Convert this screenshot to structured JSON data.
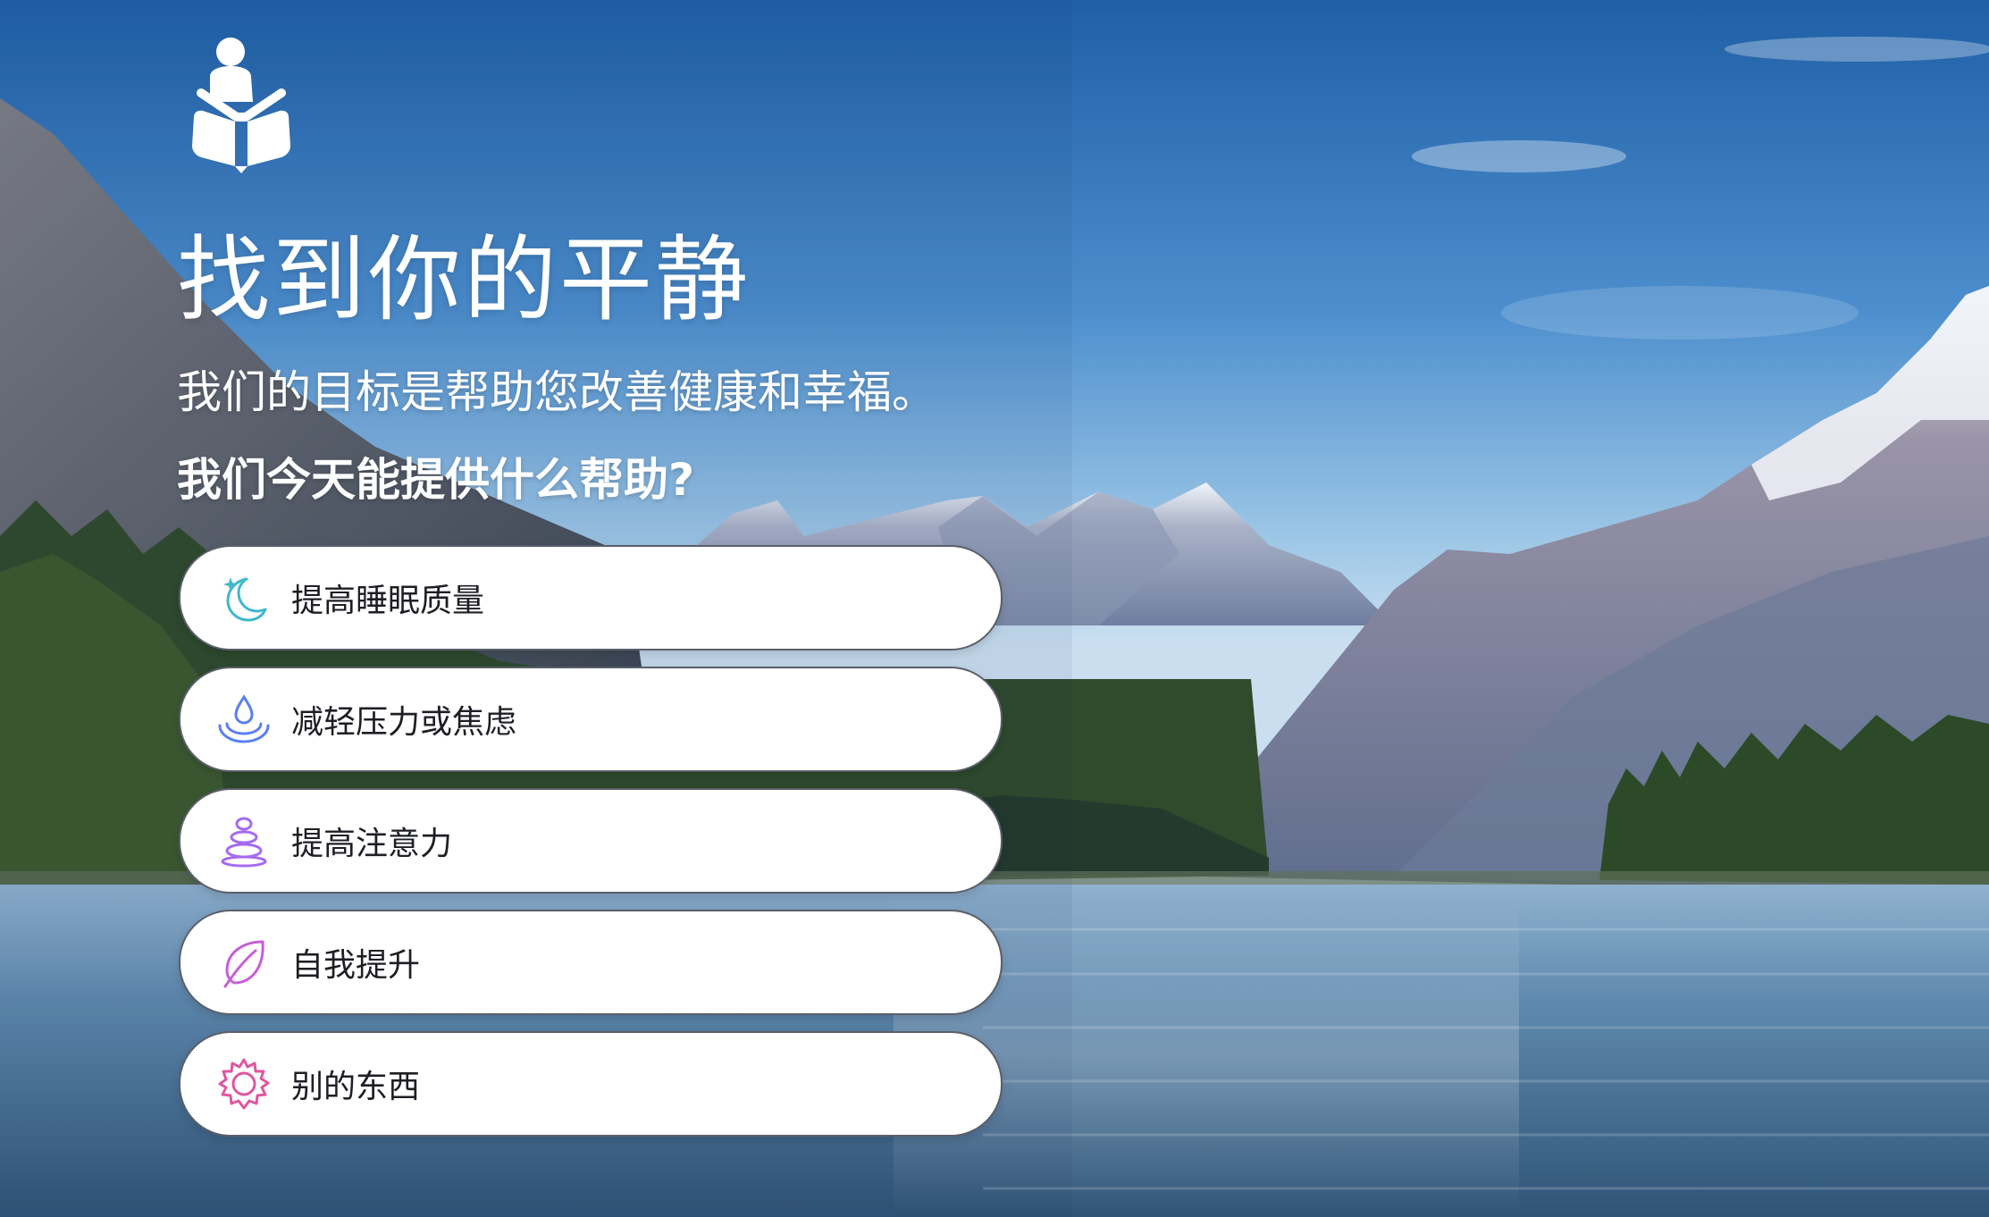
{
  "app": {
    "title": "找到你的平静",
    "subtitle": "我们的目标是帮助您改善健康和幸福。",
    "question": "我们今天能提供什么帮助?"
  },
  "icons": {
    "logo": "meditating-person-book-icon"
  },
  "options": [
    {
      "label": "提高睡眠质量",
      "icon": "moon-sparkle-icon",
      "color": "#3fb8c9"
    },
    {
      "label": "减轻压力或焦虑",
      "icon": "water-drop-ripple-icon",
      "color": "#5a7ff0"
    },
    {
      "label": "提高注意力",
      "icon": "stacked-stones-icon",
      "color": "#a56bf0"
    },
    {
      "label": "自我提升",
      "icon": "leaf-icon",
      "color": "#c65fd8"
    },
    {
      "label": "别的东西",
      "icon": "sun-gear-icon",
      "color": "#e0569f"
    }
  ]
}
